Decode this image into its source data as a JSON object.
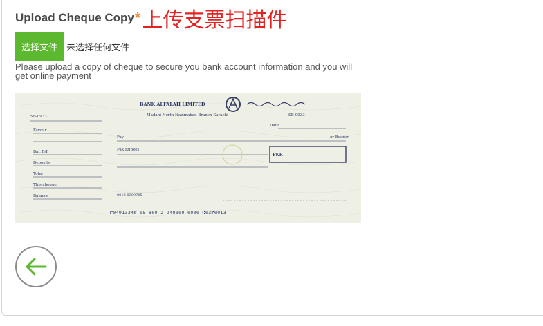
{
  "upload": {
    "title": "Upload Cheque Copy",
    "required_mark": "*",
    "title_cn": "上传支票扫描件",
    "choose_file_label": "选择文件",
    "file_status": "未选择任何文件",
    "hint": "Please upload a copy of cheque to secure you bank account information and you will get online payment"
  },
  "cheque": {
    "bank_name": "BANK ALFALAH LIMITED",
    "branch": "Madani North Nazimabad Branch Karachi",
    "branch_code": "SB-0933",
    "left_code": "SB-0933",
    "stub_labels": [
      "Favour",
      "Bal. B/F",
      "Deposits",
      "Total",
      "This cheque",
      "Balance"
    ],
    "date_label": "Date",
    "pay_label": "Pay",
    "bearer_label": "or Bearer",
    "rupees_label": "Pak Rupees",
    "pkr_label": "PKR",
    "account_no": "0010-0399765",
    "micr_line": "⑈0491334⑈ 05 800 2 940000 0000 ⑆03⑈0013",
    "colors": {
      "paper": "#eef0e6",
      "line": "#3a3f66",
      "print": "#2e3766"
    }
  },
  "nav": {
    "back_icon": "arrow-left-circle-icon",
    "arrow_color": "#5cb82e"
  }
}
